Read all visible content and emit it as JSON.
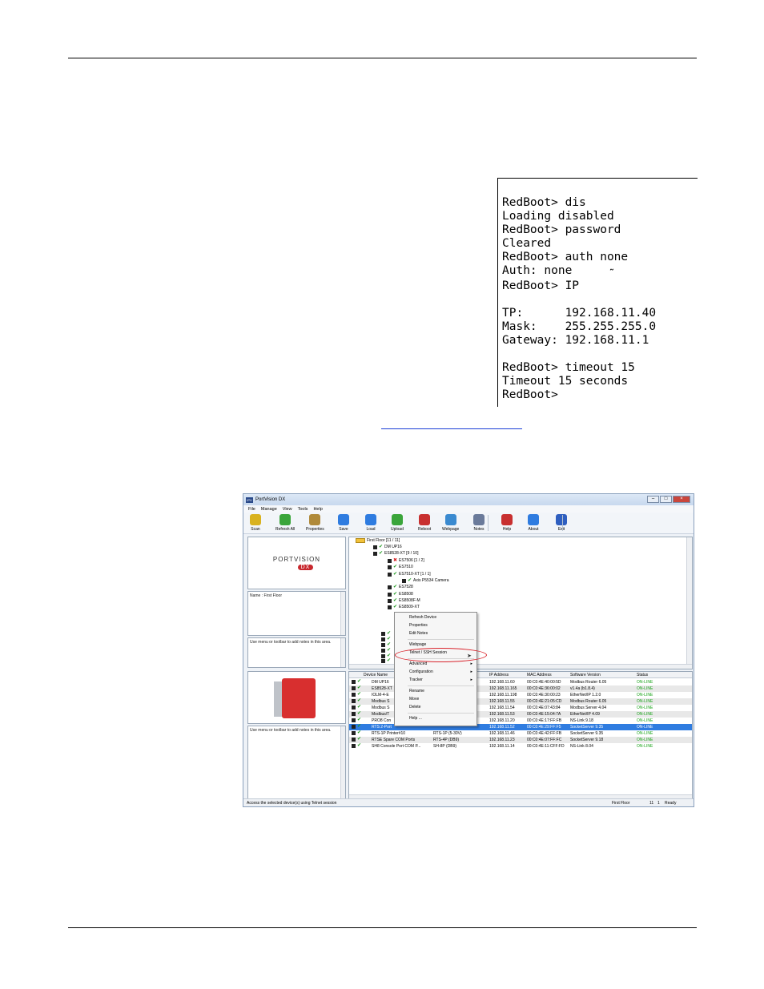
{
  "terminal": {
    "lines": [
      "RedBoot> dis",
      "Loading disabled",
      "RedBoot> password",
      "Cleared",
      "RedBoot> auth none",
      "Auth: none",
      "RedBoot> IP",
      "",
      "TP:      192.168.11.40",
      "Mask:    255.255.255.0",
      "Gateway: 192.168.11.1",
      "",
      "RedBoot> timeout 15",
      "Timeout 15 seconds",
      "RedBoot>"
    ],
    "cursor_char": "˜"
  },
  "app": {
    "title": "PortVision DX",
    "logo_text": "IPV",
    "menu": [
      "File",
      "Manage",
      "View",
      "Tools",
      "Help"
    ],
    "toolbar": [
      {
        "label": "Scan",
        "icon": "scan-icon",
        "color": "#d9b21f"
      },
      {
        "label": "Refresh All",
        "icon": "refresh-icon",
        "color": "#3aa53a"
      },
      {
        "label": "Properties",
        "icon": "properties-icon",
        "color": "#b08a3a"
      },
      {
        "label": "Save",
        "icon": "save-icon",
        "color": "#2f7ce0"
      },
      {
        "label": "Load",
        "icon": "load-icon",
        "color": "#2f7ce0"
      },
      {
        "label": "Upload",
        "icon": "upload-icon",
        "color": "#3aa53a"
      },
      {
        "label": "Reboot",
        "icon": "reboot-icon",
        "color": "#c83030"
      },
      {
        "label": "Webpage",
        "icon": "webpage-icon",
        "color": "#3a8ad0"
      },
      {
        "label": "Notes",
        "icon": "notes-icon",
        "color": "#6a7a9a"
      },
      {
        "label": "Help",
        "icon": "help-icon",
        "color": "#c83030"
      },
      {
        "label": "About",
        "icon": "about-icon",
        "color": "#2f7ce0"
      },
      {
        "label": "Exit",
        "icon": "exit-icon",
        "color": "#2f5fc0"
      }
    ],
    "brand": {
      "name": "PORTVISION",
      "badge": "DX"
    },
    "name_label": "Name : First Floor",
    "notes_hint": "Use menu or toolbar to add notes in this area.",
    "tree": [
      {
        "text": "First Floor [11 / 11]",
        "kind": "folder"
      },
      {
        "text": "DM UP16",
        "kind": "ok"
      },
      {
        "text": "ES8528-XT [9 / 10]",
        "kind": "ok"
      },
      {
        "text": "ES7506 [1 / 2]",
        "kind": "err"
      },
      {
        "text": "ES7510",
        "kind": "ok"
      },
      {
        "text": "ES7510-XT [1 / 1]",
        "kind": "ok"
      },
      {
        "text": "Axis P5534 Camera",
        "kind": "ok"
      },
      {
        "text": "ES7528",
        "kind": "ok"
      },
      {
        "text": "ES8508",
        "kind": "ok"
      },
      {
        "text": "ES8508F-M",
        "kind": "ok"
      },
      {
        "text": "ES8509-XT",
        "kind": "ok"
      }
    ],
    "context_menu": {
      "items": [
        {
          "label": "Refresh Device"
        },
        {
          "label": "Properties"
        },
        {
          "label": "Edit Notes"
        },
        {
          "label": "Webpage"
        },
        {
          "label": "Telnet / SSH Session"
        },
        {
          "label": "Advanced",
          "submenu": true
        },
        {
          "label": "Configuration",
          "submenu": true
        },
        {
          "label": "Tracker",
          "submenu": true
        },
        {
          "label": "Rename"
        },
        {
          "label": "Move"
        },
        {
          "label": "Delete"
        },
        {
          "label": "Help ..."
        }
      ]
    },
    "list": {
      "columns": [
        "Device Name",
        "IP Address",
        "MAC Address",
        "Software Version",
        "Status"
      ],
      "rows": [
        {
          "name": "DM UP16",
          "model": "",
          "ip": "192.168.11.60",
          "mac": "00:C0:4E:40:00:5D",
          "sw": "Modbus Router 6.05",
          "status": "ON-LINE"
        },
        {
          "name": "ES8528-XT",
          "model": "",
          "ip": "192.168.11.165",
          "mac": "00:C0:4E:36:00:02",
          "sw": "v1.4a  (b1.8.4)",
          "status": "ON-LINE"
        },
        {
          "name": "IOLM-4-E",
          "model": "",
          "ip": "192.168.11.198",
          "mac": "00:C0:4E:30:00:23",
          "sw": "EtherNet/IP 1.2.0",
          "status": "ON-LINE"
        },
        {
          "name": "Modbus S",
          "model": "",
          "ip": "192.168.11.55",
          "mac": "00:C0:4E:21:05:CD",
          "sw": "Modbus Router 6.05",
          "status": "ON-LINE"
        },
        {
          "name": "Modbus S",
          "model": "",
          "ip": "192.168.11.54",
          "mac": "00:C0:4E:07:43:84",
          "sw": "Modbus Server 4.04",
          "status": "ON-LINE"
        },
        {
          "name": "Modbus/T",
          "model": "",
          "ip": "192.168.11.53",
          "mac": "00:C0:4E:15:04:7A",
          "sw": "EtherNet/IP 4.09",
          "status": "ON-LINE"
        },
        {
          "name": "PRO8 Con",
          "model": "",
          "ip": "192.168.11.20",
          "mac": "00:C0:4E:17:FF:FB",
          "sw": "NS-Link 9.18",
          "status": "ON-LINE"
        },
        {
          "name": "RTS 2-Port",
          "model": "",
          "ip": "192.168.11.52",
          "mac": "00:C0:4E:29:FF:F5",
          "sw": "SocketServer 9.35",
          "status": "ON-LINE"
        },
        {
          "name": "RTS-1P Printer#10",
          "model": "RTS-1P (5-30V)",
          "ip": "192.168.11.46",
          "mac": "00:C0:4E:42:FF:FB",
          "sw": "SocketServer 9.35",
          "status": "ON-LINE"
        },
        {
          "name": "RTSE Spare COM Ports",
          "model": "RTS-4P (DB9)",
          "ip": "192.168.11.23",
          "mac": "00:C0:4E:07:FF:FC",
          "sw": "SocketServer 9.18",
          "status": "ON-LINE"
        },
        {
          "name": "SH8 Console Port COM P...",
          "model": "SH-8P (DB9)",
          "ip": "192.168.11.14",
          "mac": "00:C0:4E:11:CFF:FD",
          "sw": "NS-Link 8.04",
          "status": "ON-LINE"
        }
      ],
      "selected_index": 7
    },
    "status": {
      "message": "Access the selected device(s) using Telnet session",
      "location": "First Floor",
      "count_a": "11",
      "count_b": "1",
      "state": "Ready"
    }
  },
  "colors": {
    "online": "#17a317",
    "selection": "#2f7ce0",
    "callout": "#d9262e"
  }
}
